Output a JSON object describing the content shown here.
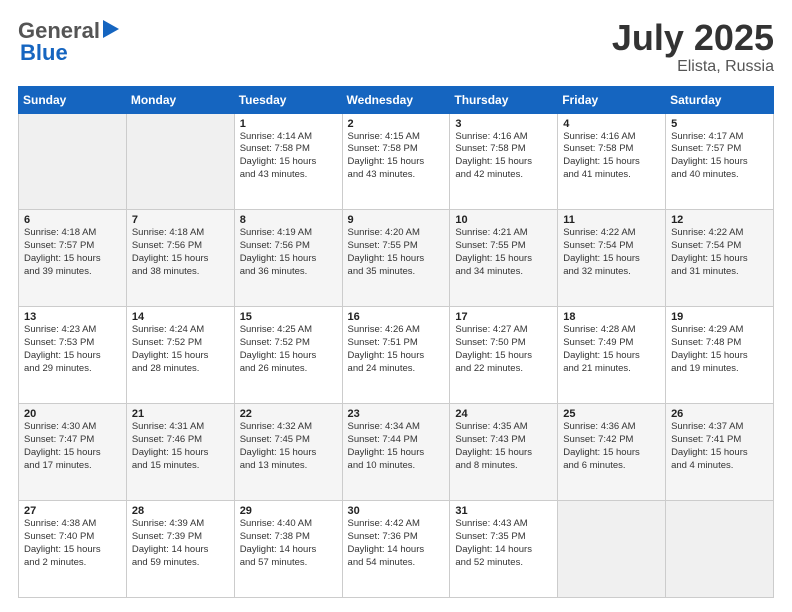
{
  "header": {
    "logo_general": "General",
    "logo_blue": "Blue",
    "month_title": "July 2025",
    "location": "Elista, Russia"
  },
  "days_of_week": [
    "Sunday",
    "Monday",
    "Tuesday",
    "Wednesday",
    "Thursday",
    "Friday",
    "Saturday"
  ],
  "weeks": [
    [
      {
        "day": "",
        "info": ""
      },
      {
        "day": "",
        "info": ""
      },
      {
        "day": "1",
        "info": "Sunrise: 4:14 AM\nSunset: 7:58 PM\nDaylight: 15 hours\nand 43 minutes."
      },
      {
        "day": "2",
        "info": "Sunrise: 4:15 AM\nSunset: 7:58 PM\nDaylight: 15 hours\nand 43 minutes."
      },
      {
        "day": "3",
        "info": "Sunrise: 4:16 AM\nSunset: 7:58 PM\nDaylight: 15 hours\nand 42 minutes."
      },
      {
        "day": "4",
        "info": "Sunrise: 4:16 AM\nSunset: 7:58 PM\nDaylight: 15 hours\nand 41 minutes."
      },
      {
        "day": "5",
        "info": "Sunrise: 4:17 AM\nSunset: 7:57 PM\nDaylight: 15 hours\nand 40 minutes."
      }
    ],
    [
      {
        "day": "6",
        "info": "Sunrise: 4:18 AM\nSunset: 7:57 PM\nDaylight: 15 hours\nand 39 minutes."
      },
      {
        "day": "7",
        "info": "Sunrise: 4:18 AM\nSunset: 7:56 PM\nDaylight: 15 hours\nand 38 minutes."
      },
      {
        "day": "8",
        "info": "Sunrise: 4:19 AM\nSunset: 7:56 PM\nDaylight: 15 hours\nand 36 minutes."
      },
      {
        "day": "9",
        "info": "Sunrise: 4:20 AM\nSunset: 7:55 PM\nDaylight: 15 hours\nand 35 minutes."
      },
      {
        "day": "10",
        "info": "Sunrise: 4:21 AM\nSunset: 7:55 PM\nDaylight: 15 hours\nand 34 minutes."
      },
      {
        "day": "11",
        "info": "Sunrise: 4:22 AM\nSunset: 7:54 PM\nDaylight: 15 hours\nand 32 minutes."
      },
      {
        "day": "12",
        "info": "Sunrise: 4:22 AM\nSunset: 7:54 PM\nDaylight: 15 hours\nand 31 minutes."
      }
    ],
    [
      {
        "day": "13",
        "info": "Sunrise: 4:23 AM\nSunset: 7:53 PM\nDaylight: 15 hours\nand 29 minutes."
      },
      {
        "day": "14",
        "info": "Sunrise: 4:24 AM\nSunset: 7:52 PM\nDaylight: 15 hours\nand 28 minutes."
      },
      {
        "day": "15",
        "info": "Sunrise: 4:25 AM\nSunset: 7:52 PM\nDaylight: 15 hours\nand 26 minutes."
      },
      {
        "day": "16",
        "info": "Sunrise: 4:26 AM\nSunset: 7:51 PM\nDaylight: 15 hours\nand 24 minutes."
      },
      {
        "day": "17",
        "info": "Sunrise: 4:27 AM\nSunset: 7:50 PM\nDaylight: 15 hours\nand 22 minutes."
      },
      {
        "day": "18",
        "info": "Sunrise: 4:28 AM\nSunset: 7:49 PM\nDaylight: 15 hours\nand 21 minutes."
      },
      {
        "day": "19",
        "info": "Sunrise: 4:29 AM\nSunset: 7:48 PM\nDaylight: 15 hours\nand 19 minutes."
      }
    ],
    [
      {
        "day": "20",
        "info": "Sunrise: 4:30 AM\nSunset: 7:47 PM\nDaylight: 15 hours\nand 17 minutes."
      },
      {
        "day": "21",
        "info": "Sunrise: 4:31 AM\nSunset: 7:46 PM\nDaylight: 15 hours\nand 15 minutes."
      },
      {
        "day": "22",
        "info": "Sunrise: 4:32 AM\nSunset: 7:45 PM\nDaylight: 15 hours\nand 13 minutes."
      },
      {
        "day": "23",
        "info": "Sunrise: 4:34 AM\nSunset: 7:44 PM\nDaylight: 15 hours\nand 10 minutes."
      },
      {
        "day": "24",
        "info": "Sunrise: 4:35 AM\nSunset: 7:43 PM\nDaylight: 15 hours\nand 8 minutes."
      },
      {
        "day": "25",
        "info": "Sunrise: 4:36 AM\nSunset: 7:42 PM\nDaylight: 15 hours\nand 6 minutes."
      },
      {
        "day": "26",
        "info": "Sunrise: 4:37 AM\nSunset: 7:41 PM\nDaylight: 15 hours\nand 4 minutes."
      }
    ],
    [
      {
        "day": "27",
        "info": "Sunrise: 4:38 AM\nSunset: 7:40 PM\nDaylight: 15 hours\nand 2 minutes."
      },
      {
        "day": "28",
        "info": "Sunrise: 4:39 AM\nSunset: 7:39 PM\nDaylight: 14 hours\nand 59 minutes."
      },
      {
        "day": "29",
        "info": "Sunrise: 4:40 AM\nSunset: 7:38 PM\nDaylight: 14 hours\nand 57 minutes."
      },
      {
        "day": "30",
        "info": "Sunrise: 4:42 AM\nSunset: 7:36 PM\nDaylight: 14 hours\nand 54 minutes."
      },
      {
        "day": "31",
        "info": "Sunrise: 4:43 AM\nSunset: 7:35 PM\nDaylight: 14 hours\nand 52 minutes."
      },
      {
        "day": "",
        "info": ""
      },
      {
        "day": "",
        "info": ""
      }
    ]
  ]
}
